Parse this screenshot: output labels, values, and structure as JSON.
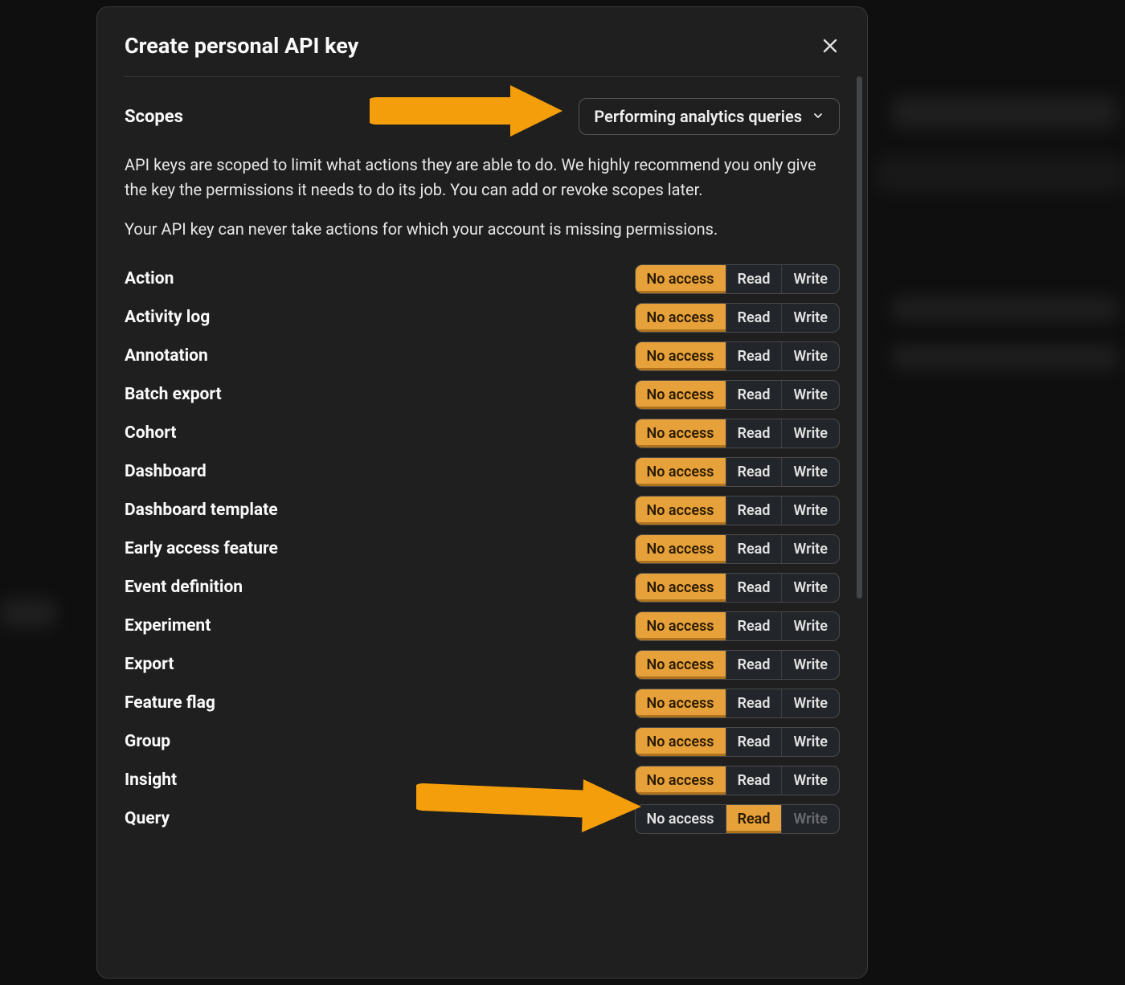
{
  "modal": {
    "title": "Create personal API key",
    "scopes_label": "Scopes",
    "preset_selected": "Performing analytics queries",
    "description1": "API keys are scoped to limit what actions they are able to do. We highly recommend you only give the key the permissions it needs to do its job. You can add or revoke scopes later.",
    "description2": "Your API key can never take actions for which your account is missing permissions."
  },
  "segment_labels": {
    "none": "No access",
    "read": "Read",
    "write": "Write"
  },
  "scopes": [
    {
      "name": "Action",
      "selected": "none"
    },
    {
      "name": "Activity log",
      "selected": "none"
    },
    {
      "name": "Annotation",
      "selected": "none"
    },
    {
      "name": "Batch export",
      "selected": "none"
    },
    {
      "name": "Cohort",
      "selected": "none"
    },
    {
      "name": "Dashboard",
      "selected": "none"
    },
    {
      "name": "Dashboard template",
      "selected": "none"
    },
    {
      "name": "Early access feature",
      "selected": "none"
    },
    {
      "name": "Event definition",
      "selected": "none"
    },
    {
      "name": "Experiment",
      "selected": "none"
    },
    {
      "name": "Export",
      "selected": "none"
    },
    {
      "name": "Feature flag",
      "selected": "none"
    },
    {
      "name": "Group",
      "selected": "none"
    },
    {
      "name": "Insight",
      "selected": "none"
    },
    {
      "name": "Query",
      "selected": "read",
      "write_disabled": true
    }
  ]
}
